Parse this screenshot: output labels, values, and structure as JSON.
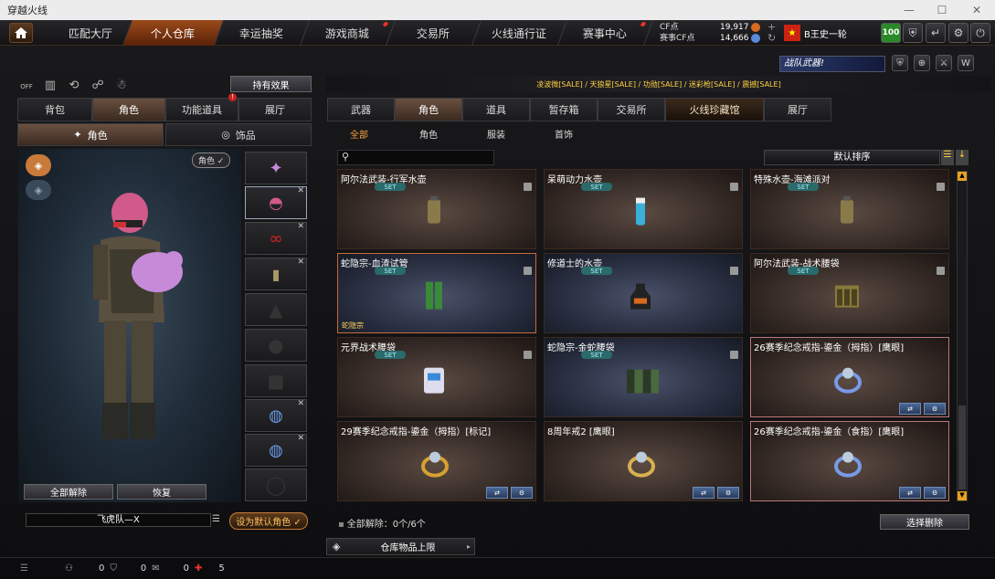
{
  "window": {
    "title": "穿越火线",
    "minimize": "—",
    "maximize": "☐",
    "close": "✕"
  },
  "topnav": {
    "tabs": [
      "匹配大厅",
      "个人仓库",
      "幸运抽奖",
      "游戏商城",
      "交易所",
      "火线通行证",
      "赛事中心"
    ],
    "active_index": 1,
    "cf_label": "CF点",
    "cf_value": "19,917",
    "match_cf_label": "赛事CF点",
    "match_cf_value": "14,666",
    "player_name": "B王史一轮",
    "level_badge": "100"
  },
  "left": {
    "effect_button": "持有效果",
    "off_label": "OFF",
    "tabs": [
      "背包",
      "角色",
      "功能道具",
      "展厅"
    ],
    "active_tab": 1,
    "subtabs": [
      "角色",
      "饰品"
    ],
    "role_badge": "角色 ✓",
    "unequip_all": "全部解除",
    "restore": "恢复",
    "char_name": "飞虎队—X",
    "set_default": "设为默认角色 ✓"
  },
  "right": {
    "tabs": [
      "武器",
      "角色",
      "道具",
      "暂存箱",
      "交易所",
      "火线珍藏馆",
      "展厅"
    ],
    "active_tab": 1,
    "subtabs": [
      "全部",
      "角色",
      "服装",
      "首饰"
    ],
    "active_sub": 0,
    "banner_title": "战队武器!",
    "sale_marquee": "凌波微[SALE] / 天狼星[SALE] / 功勋[SALE] / 迷彩枪[SALE] / 震撼[SALE]",
    "sort_label": "默认排序",
    "set_tag": "SET",
    "items": [
      {
        "name": "阿尔法武装-行军水壶",
        "style": "brown",
        "set": true
      },
      {
        "name": "呆萌动力水壶",
        "style": "brown",
        "set": true
      },
      {
        "name": "特殊水壶-海滩派对",
        "style": "brown",
        "set": true
      },
      {
        "name": "蛇隐宗-血渣试管",
        "style": "blue",
        "set": true,
        "tag": "蛇隐宗",
        "hl": true
      },
      {
        "name": "修道士的水壶",
        "style": "blue",
        "set": true
      },
      {
        "name": "阿尔法武装-战术腰袋",
        "style": "brown",
        "set": true
      },
      {
        "name": "元界战术腰袋",
        "style": "brown",
        "set": true
      },
      {
        "name": "蛇隐宗-金蛇腰袋",
        "style": "blue",
        "set": true
      },
      {
        "name": "26赛季纪念戒指-鎏金（拇指）[鹰眼]",
        "style": "brown",
        "pink": true,
        "acts": true
      },
      {
        "name": "29赛季纪念戒指-鎏金（拇指）[标记]",
        "style": "brown",
        "acts": true
      },
      {
        "name": "8周年戒2 [鹰眼]",
        "style": "brown",
        "acts": true
      },
      {
        "name": "26赛季纪念戒指-鎏金（食指）[鹰眼]",
        "style": "brown",
        "pink": true,
        "acts": true
      }
    ],
    "unequip_status": "全部解除：0个/6个",
    "select_delete": "选择删除",
    "warehouse_limit": "仓库物品上限"
  },
  "bottom": {
    "count1": "0",
    "count2": "0",
    "count3": "0",
    "count4": "5"
  }
}
